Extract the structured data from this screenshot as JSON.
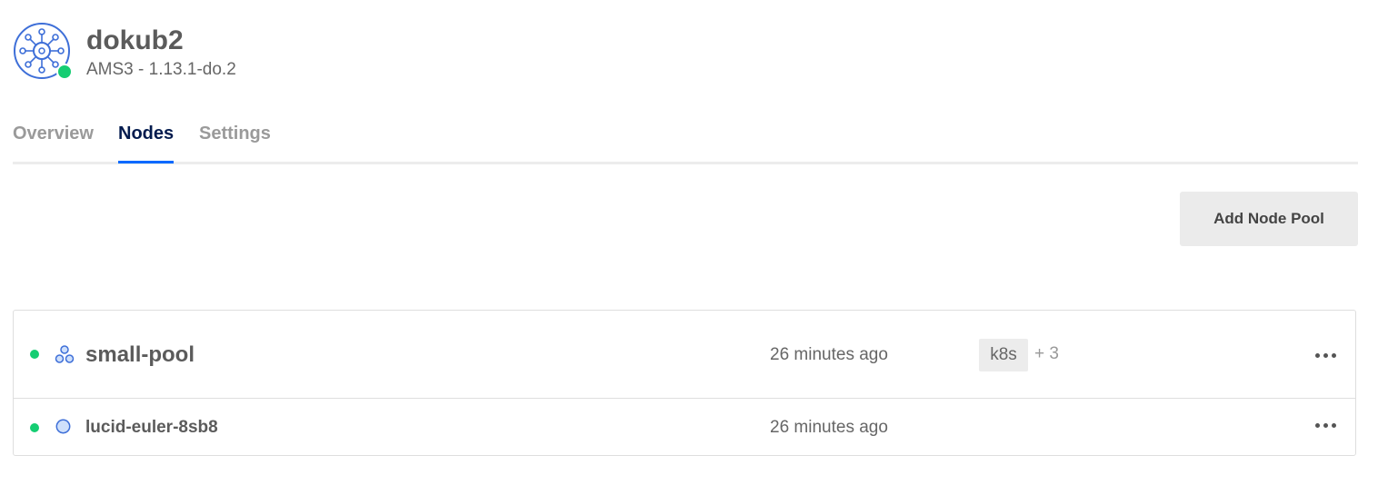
{
  "cluster": {
    "name": "dokub2",
    "subtitle": "AMS3 - 1.13.1-do.2",
    "icon": "kubernetes-helm-icon",
    "status_color": "#15cd72"
  },
  "tabs": [
    {
      "label": "Overview",
      "active": false
    },
    {
      "label": "Nodes",
      "active": true
    },
    {
      "label": "Settings",
      "active": false
    }
  ],
  "actions": {
    "add_node_pool_label": "Add Node Pool"
  },
  "pools": [
    {
      "name": "small-pool",
      "icon": "node-pool-icon",
      "created": "26 minutes ago",
      "tag": "k8s",
      "tag_more": "+ 3",
      "status": "running"
    }
  ],
  "nodes": [
    {
      "name": "lucid-euler-8sb8",
      "icon": "node-icon",
      "created": "26 minutes ago",
      "status": "running"
    }
  ],
  "colors": {
    "accent": "#0069ff",
    "active_tab": "#031b4e",
    "status_green": "#15cd72"
  }
}
